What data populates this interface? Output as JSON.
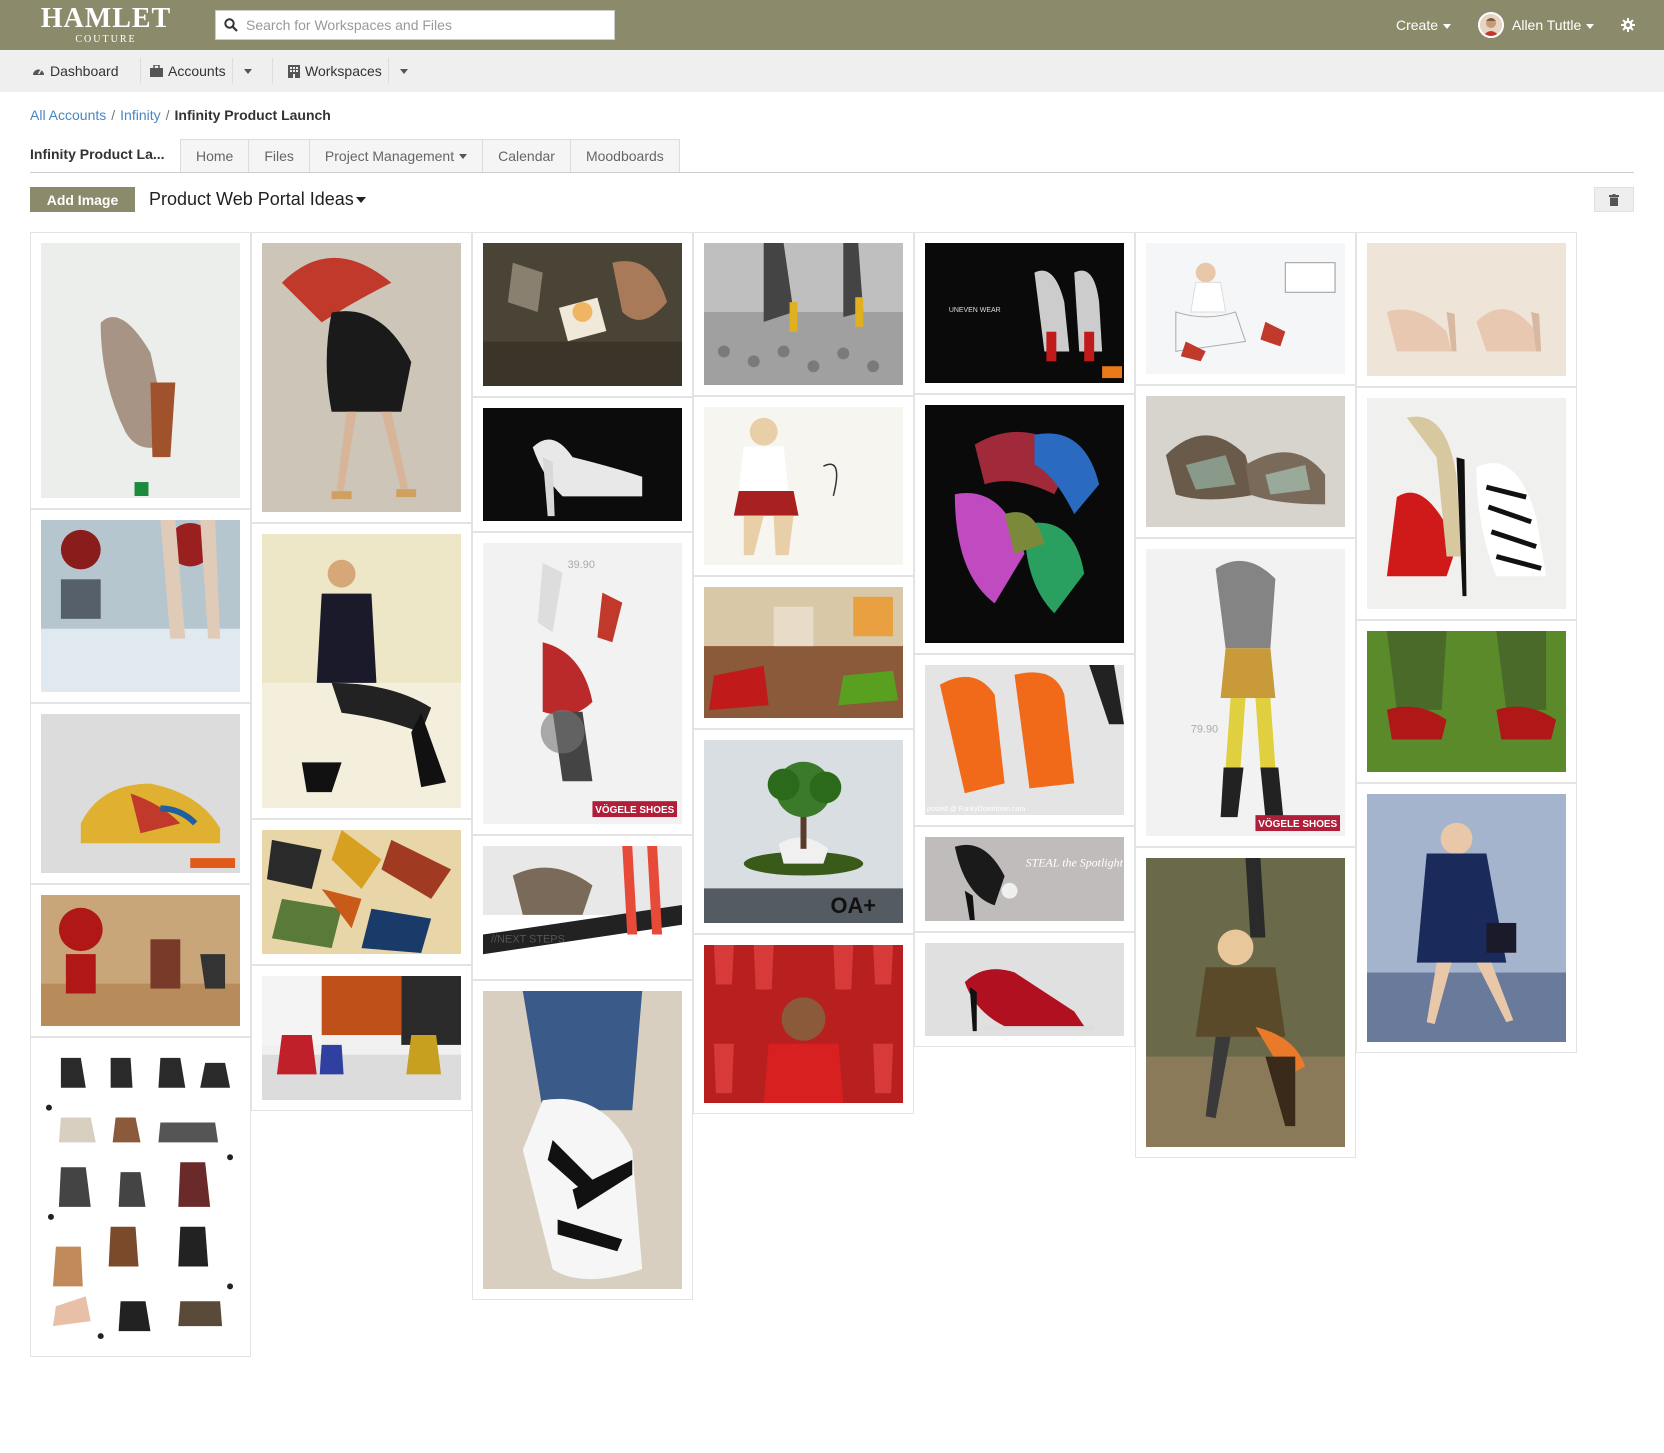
{
  "header": {
    "logo_main": "HAMLET",
    "logo_sub": "COUTURE",
    "search_placeholder": "Search for Workspaces and Files",
    "create_label": "Create",
    "user_name": "Allen Tuttle"
  },
  "nav": {
    "dashboard": "Dashboard",
    "accounts": "Accounts",
    "workspaces": "Workspaces"
  },
  "breadcrumb": {
    "all_accounts": "All Accounts",
    "account": "Infinity",
    "current": "Infinity Product Launch",
    "separator": "/"
  },
  "workspace": {
    "title": "Infinity Product La...",
    "tabs": [
      "Home",
      "Files",
      "Project Management",
      "Calendar",
      "Moodboards"
    ]
  },
  "moodboard": {
    "add_image_label": "Add Image",
    "title": "Product Web Portal Ideas"
  },
  "image_captions": {
    "vogele_1": "VÖGELE SHOES",
    "vogele_2": "VÖGELE SHOES",
    "oat": "OA+",
    "next_steps": "//NEXT STEPS",
    "price_1": "39.90",
    "price_2": "79.90",
    "steal": "STEAL the Spotlight",
    "funky": "posted @ FunkyDowntown.com",
    "uneven": "UNEVEN WEAR"
  },
  "colors": {
    "brand": "#8b8b6b",
    "link": "#4a86c5",
    "nav_bg": "#efefef"
  }
}
